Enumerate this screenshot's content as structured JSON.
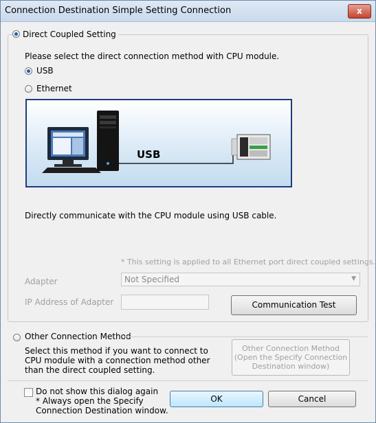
{
  "window": {
    "title": "Connection Destination Simple Setting Connection",
    "close_label": "x"
  },
  "direct": {
    "legend": "Direct Coupled Setting",
    "prompt": "Please select the direct connection method with CPU module.",
    "usb_label": "USB",
    "ethernet_label": "Ethernet",
    "diagram_label": "USB",
    "description": "Directly communicate with the CPU module using USB cable.",
    "note": "* This setting is applied to all Ethernet port direct coupled settings.",
    "adapter_label": "Adapter",
    "adapter_value": "Not Specified",
    "ip_label": "IP Address of Adapter",
    "ip_value": "",
    "comm_test_label": "Communication Test"
  },
  "other": {
    "legend": "Other Connection Method",
    "description_line1": "Select this method if you want to connect to",
    "description_line2": "CPU module with a connection method other",
    "description_line3": "than the direct coupled setting.",
    "button_line1": "Other Connection Method",
    "button_line2": "(Open the Specify Connection",
    "button_line3": "Destination window)"
  },
  "footer": {
    "checkbox_line1": "Do not show this dialog again",
    "checkbox_line2": "* Always open the Specify",
    "checkbox_line3": "Connection Destination window.",
    "ok_label": "OK",
    "cancel_label": "Cancel"
  },
  "colors": {
    "accent": "#1a5fb4",
    "diagram_border": "#1f3b7c",
    "close": "#c5442f"
  }
}
